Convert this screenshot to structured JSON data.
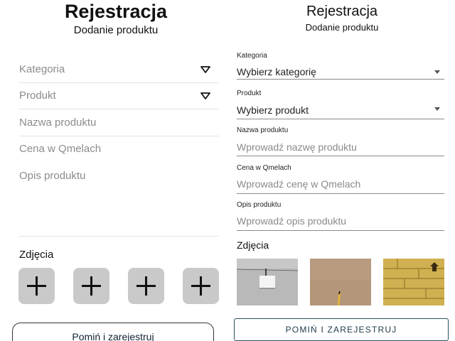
{
  "left": {
    "title": "Rejestracja",
    "subtitle": "Dodanie produktu",
    "fields": {
      "category": "Kategoria",
      "product": "Produkt",
      "product_name": "Nazwa produktu",
      "price": "Cena w Qmelach",
      "description": "Opis produktu"
    },
    "photos_label": "Zdjęcia",
    "add_photo_icon": "plus-icon",
    "skip_button": "Pomiń i zarejestruj"
  },
  "right": {
    "title": "Rejestracja",
    "subtitle": "Dodanie produktu",
    "fields": {
      "category": {
        "label": "Kategoria",
        "value": "Wybierz kategorię"
      },
      "product": {
        "label": "Produkt",
        "value": "Wybierz produkt"
      },
      "product_name": {
        "label": "Nazwa produktu",
        "placeholder": "Wprowadź nazwę produktu"
      },
      "price": {
        "label": "Cena w Qmelach",
        "placeholder": "Wprowadź cenę w Qmelach"
      },
      "description": {
        "label": "Opis produktu",
        "placeholder": "Wprowadź opis produktu"
      }
    },
    "photos_label": "Zdjęcia",
    "skip_button": "POMIŃ I ZAREJESTRUJ"
  },
  "colors": {
    "tile_gray": "#c9c9c9",
    "hint_gray": "#8a8a8a",
    "button_border": "#2b4f5f"
  }
}
